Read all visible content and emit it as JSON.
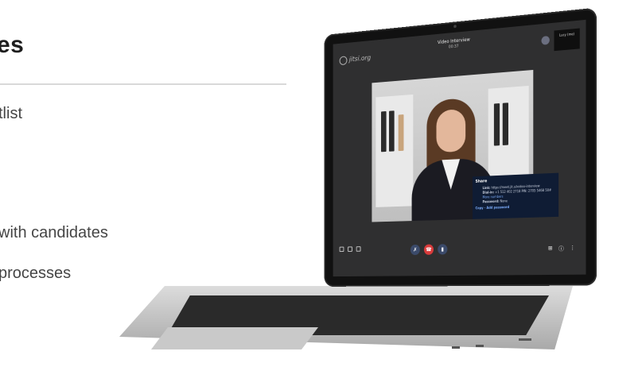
{
  "background": {
    "heading": "es",
    "lines": [
      "tlist",
      " with candidates",
      " processes"
    ]
  },
  "meeting": {
    "logo_text": "jitsi.org",
    "title": "Video Interview",
    "timer": "00:37",
    "self_view_label": "Lucy (me)",
    "share": {
      "title": "Share",
      "link_label": "Link:",
      "link_value": "https://meet.jit.si/video-interview",
      "dialin_label": "Dial-in:",
      "dialin_value": "+1 512 402 2718 PIN: 2705 5468 50#",
      "more_numbers": "More numbers",
      "password_label": "Password:",
      "password_value": "None",
      "copy_button": "Copy",
      "add_password_button": "Add password"
    }
  },
  "colors": {
    "screen_bg": "#2f2f30",
    "popup_bg": "#0f1c34",
    "hangup": "#d93b3b",
    "accent_link": "#7fb0ff"
  }
}
